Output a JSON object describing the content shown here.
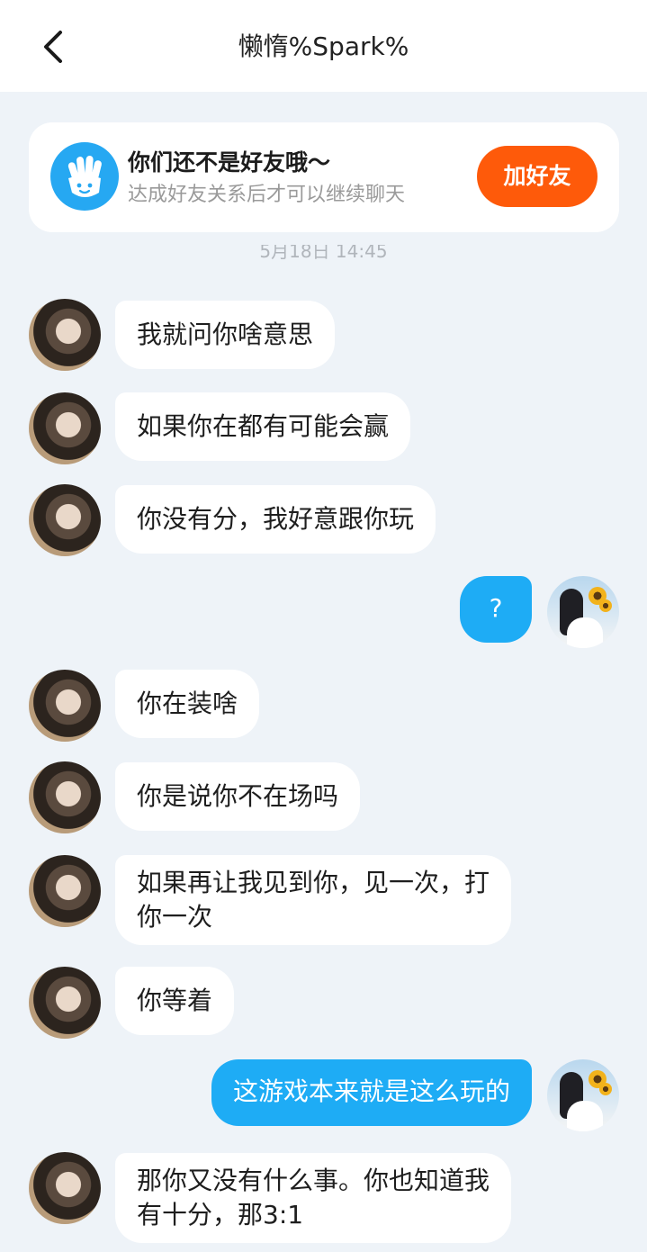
{
  "header": {
    "title": "懒惰%Spark%"
  },
  "banner": {
    "title": "你们还不是好友哦～",
    "subtitle": "达成好友关系后才可以继续聊天",
    "button": "加好友"
  },
  "timestamp": "5月18日 14:45",
  "messages": [
    {
      "sender": "peer",
      "text": "我就问你啥意思"
    },
    {
      "sender": "peer",
      "text": "如果你在都有可能会赢"
    },
    {
      "sender": "peer",
      "text": "你没有分，我好意跟你玩"
    },
    {
      "sender": "self",
      "text": "?"
    },
    {
      "sender": "peer",
      "text": "你在装啥"
    },
    {
      "sender": "peer",
      "text": "你是说你不在场吗"
    },
    {
      "sender": "peer",
      "text": "如果再让我见到你，见一次，打\n你一次"
    },
    {
      "sender": "peer",
      "text": "你等着"
    },
    {
      "sender": "self",
      "text": "这游戏本来就是这么玩的"
    },
    {
      "sender": "peer",
      "text": "那你又没有什么事。你也知道我\n有十分，那3:1"
    }
  ],
  "colors": {
    "background": "#eef3f8",
    "self_bubble": "#1eacf5",
    "add_button": "#fe5a0a",
    "banner_icon": "#26a8f2"
  },
  "icons": {
    "back": "chevron-left-icon",
    "banner": "hand-wave-icon"
  }
}
